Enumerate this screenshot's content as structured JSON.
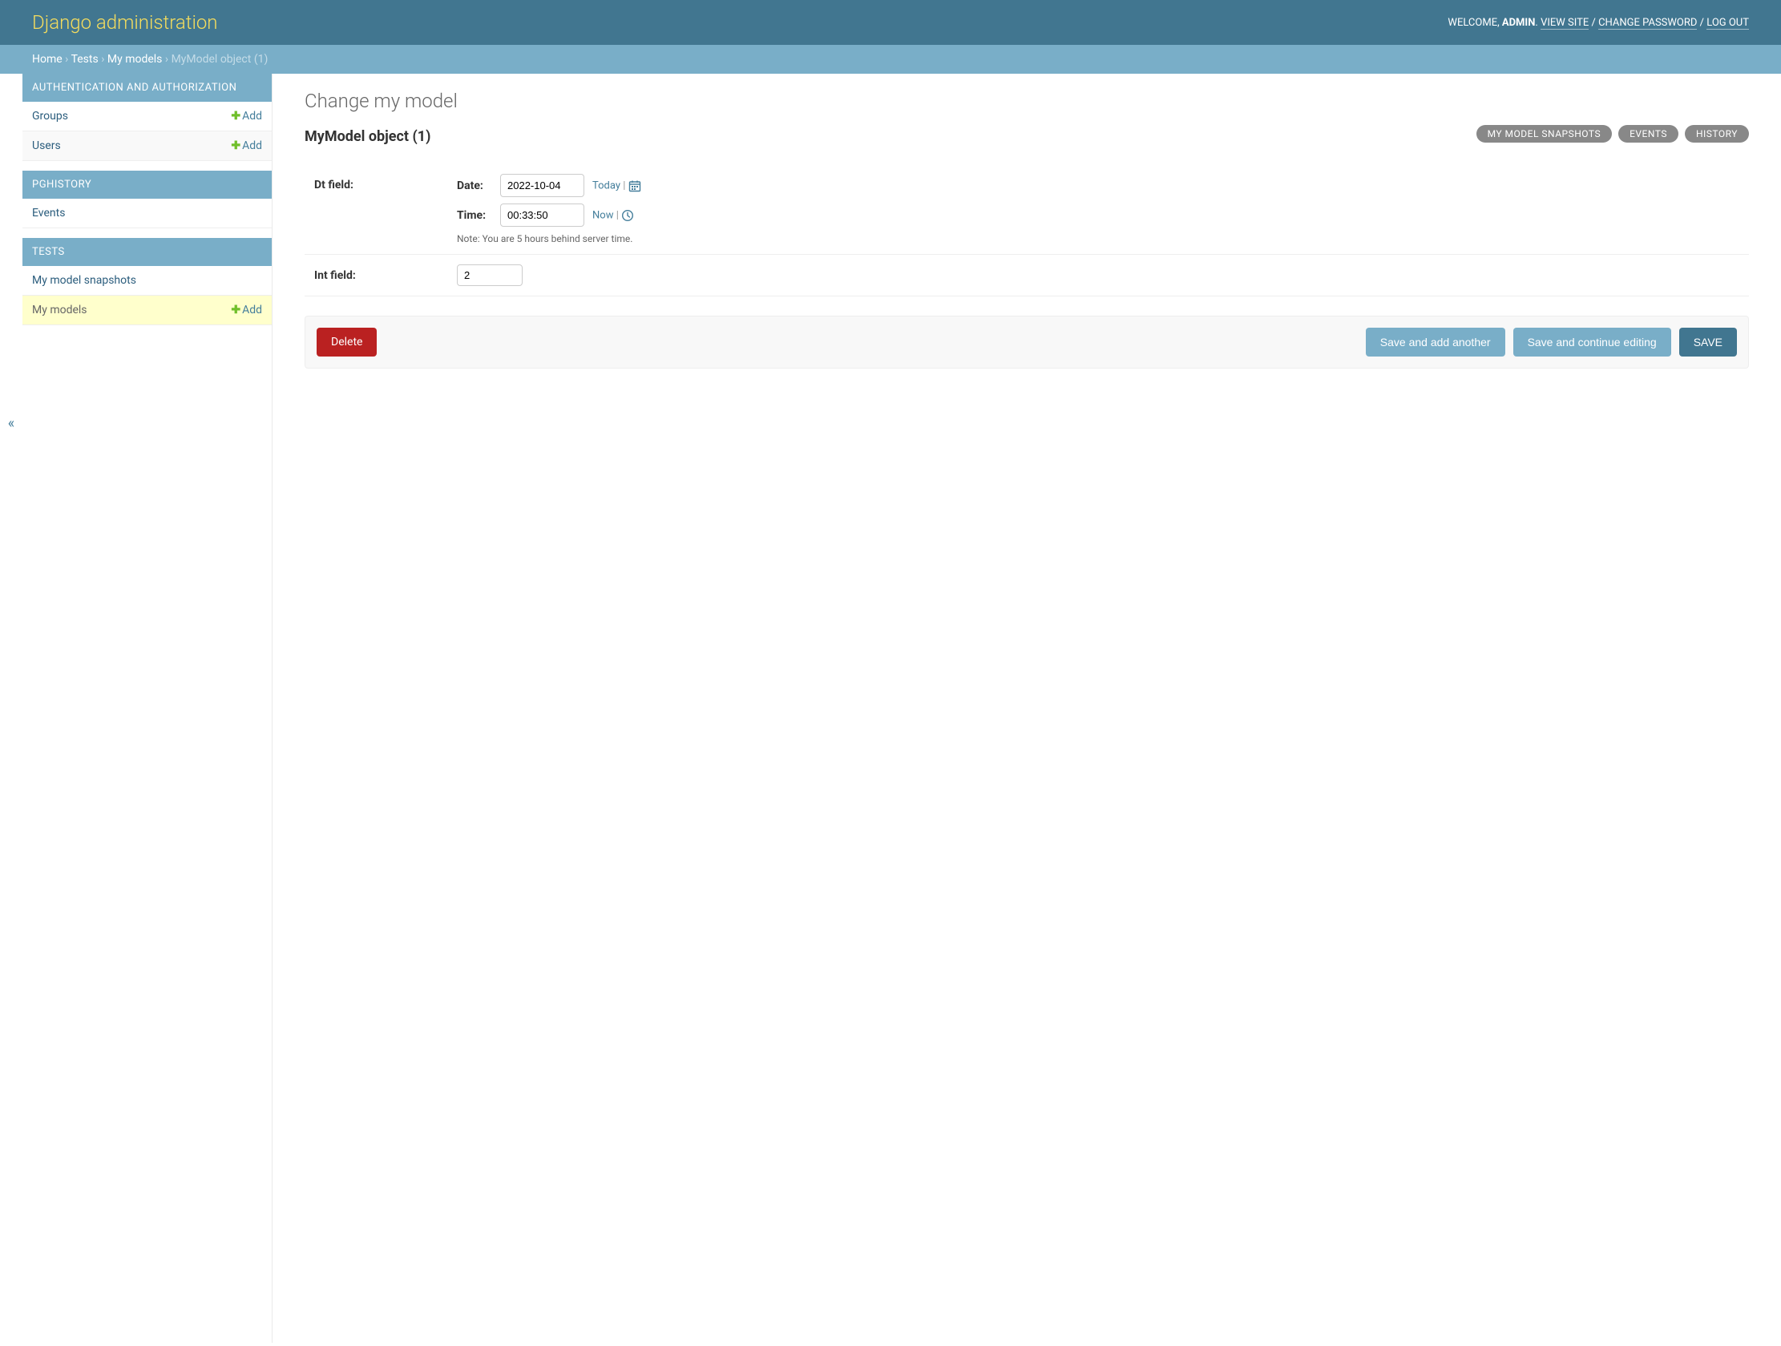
{
  "header": {
    "site_name": "Django administration",
    "welcome": "WELCOME, ",
    "user": "ADMIN",
    "period": ". ",
    "view_site": "VIEW SITE",
    "change_password": "CHANGE PASSWORD",
    "log_out": "LOG OUT",
    "sep": " / "
  },
  "breadcrumbs": {
    "home": "Home",
    "app": "Tests",
    "model": "My models",
    "current": "MyModel object (1)",
    "sep": " › "
  },
  "sidebar": {
    "apps": [
      {
        "label": "AUTHENTICATION AND AUTHORIZATION",
        "models": [
          {
            "name": "Groups",
            "add": "Add"
          },
          {
            "name": "Users",
            "add": "Add"
          }
        ]
      },
      {
        "label": "PGHISTORY",
        "models": [
          {
            "name": "Events"
          }
        ]
      },
      {
        "label": "TESTS",
        "models": [
          {
            "name": "My model snapshots"
          },
          {
            "name": "My models",
            "add": "Add",
            "current": true
          }
        ]
      }
    ]
  },
  "content": {
    "title": "Change my model",
    "object_title": "MyModel object (1)",
    "tools": {
      "snapshots": "MY MODEL SNAPSHOTS",
      "events": "EVENTS",
      "history": "HISTORY"
    },
    "fields": {
      "dt_label": "Dt field:",
      "date_label": "Date:",
      "date_value": "2022-10-04",
      "today": "Today",
      "time_label": "Time:",
      "time_value": "00:33:50",
      "now": "Now",
      "pipe": " | ",
      "tz_note": "Note: You are 5 hours behind server time.",
      "int_label": "Int field:",
      "int_value": "2"
    },
    "buttons": {
      "delete": "Delete",
      "save_add": "Save and add another",
      "save_continue": "Save and continue editing",
      "save": "SAVE"
    }
  }
}
